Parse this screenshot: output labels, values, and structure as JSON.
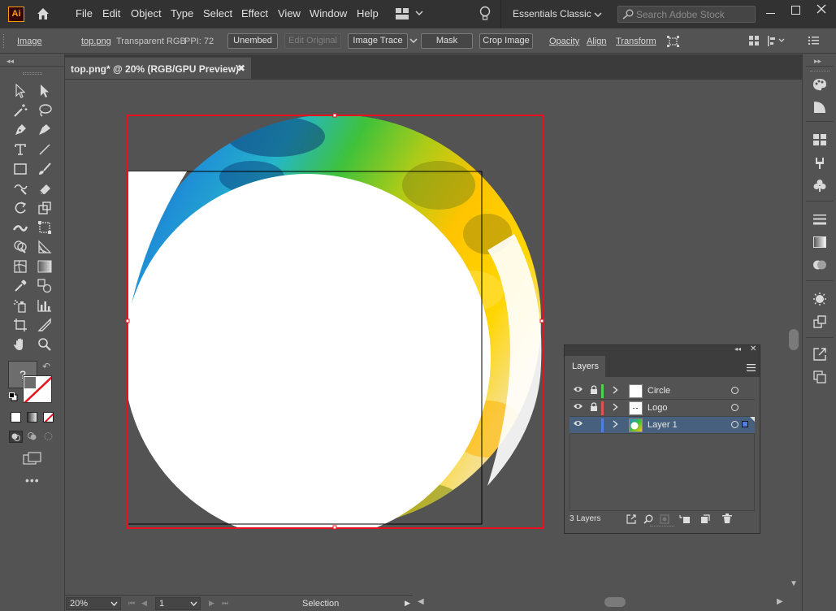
{
  "app": {
    "logo_text": "Ai",
    "menus": [
      "File",
      "Edit",
      "Object",
      "Type",
      "Select",
      "Effect",
      "View",
      "Window",
      "Help"
    ],
    "workspace": "Essentials Classic",
    "search_placeholder": "Search Adobe Stock"
  },
  "control_bar": {
    "object_type": "Image",
    "filename": "top.png",
    "color_mode": "Transparent RGB",
    "ppi": "PPI: 72",
    "unembed": "Unembed",
    "edit_original": "Edit Original",
    "image_trace": "Image Trace",
    "mask": "Mask",
    "crop_image": "Crop Image",
    "opacity": "Opacity",
    "align": "Align",
    "transform": "Transform"
  },
  "document": {
    "tab_title": "top.png* @ 20% (RGB/GPU Preview)",
    "close_glyph": "✖"
  },
  "status_bar": {
    "zoom": "20%",
    "artboard": "1",
    "tool": "Selection"
  },
  "layers_panel": {
    "tab_label": "Layers",
    "count_label": "3 Layers",
    "layers": [
      {
        "name": "Circle",
        "color": "#4fd14f",
        "locked": true,
        "selected": false
      },
      {
        "name": "Logo",
        "color": "#e05252",
        "locked": true,
        "selected": false
      },
      {
        "name": "Layer 1",
        "color": "#4f7fe0",
        "locked": false,
        "selected": true
      }
    ]
  },
  "colors": {
    "selection_red": "#e8121f",
    "layer_selected": "#46607d"
  }
}
